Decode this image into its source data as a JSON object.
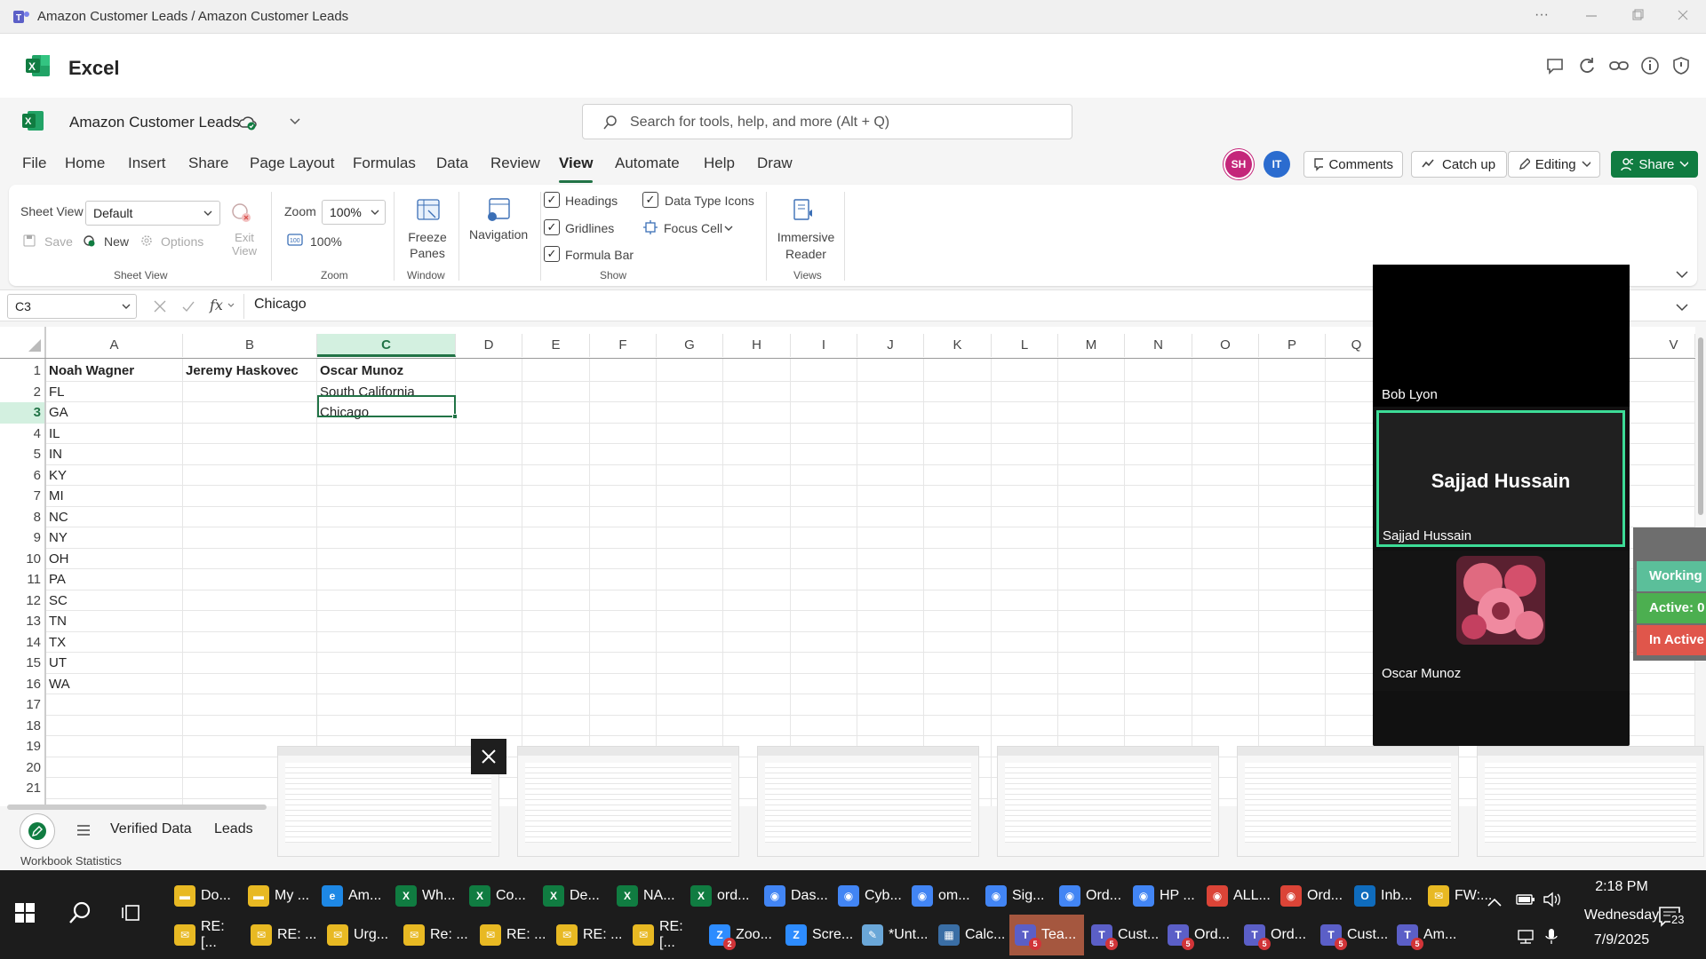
{
  "titlebar": {
    "title": "Amazon Customer Leads / Amazon Customer Leads",
    "more": "···"
  },
  "excel": {
    "app_name": "Excel"
  },
  "doc": {
    "title": "Amazon Customer Leads",
    "search_placeholder": "Search for tools, help, and more (Alt + Q)"
  },
  "menu": {
    "tabs": [
      "File",
      "Home",
      "Insert",
      "Share",
      "Page Layout",
      "Formulas",
      "Data",
      "Review",
      "View",
      "Automate",
      "Help",
      "Draw"
    ],
    "active_tab": "View",
    "avatars": [
      {
        "initials": "SH",
        "color": "#c4267a"
      },
      {
        "initials": "IT",
        "color": "#2b6ccf"
      }
    ],
    "comments": "Comments",
    "catch_up": "Catch up",
    "editing": "Editing",
    "share": "Share"
  },
  "ribbon": {
    "sheet_view_label": "Sheet View",
    "sheet_view_value": "Default",
    "save": "Save",
    "new": "New",
    "options": "Options",
    "exit_view": "Exit View",
    "group_sheet_view": "Sheet View",
    "zoom_label": "Zoom",
    "zoom_value": "100%",
    "zoom_100": "100%",
    "group_zoom": "Zoom",
    "freeze_panes": "Freeze Panes",
    "group_window": "Window",
    "navigation": "Navigation",
    "headings": "Headings",
    "gridlines": "Gridlines",
    "formula_bar": "Formula Bar",
    "data_type_icons": "Data Type Icons",
    "focus_cell": "Focus Cell",
    "group_show": "Show",
    "immersive_reader": "Immersive Reader",
    "group_views": "Views"
  },
  "formula": {
    "name_box": "C3",
    "fx": "fx",
    "value": "Chicago"
  },
  "grid": {
    "columns": [
      "A",
      "B",
      "C",
      "D",
      "E",
      "F",
      "G",
      "H",
      "I",
      "J",
      "K",
      "L",
      "M",
      "N",
      "O",
      "P",
      "Q",
      "V"
    ],
    "selected_column": "C",
    "rows": [
      "1",
      "2",
      "3",
      "4",
      "5",
      "6",
      "7",
      "8",
      "9",
      "10",
      "11",
      "12",
      "13",
      "14",
      "15",
      "16",
      "17",
      "18",
      "19",
      "20",
      "21"
    ],
    "selected_row": "3",
    "cells": {
      "A": [
        "Noah Wagner",
        "FL",
        "GA",
        "IL",
        "IN",
        "KY",
        "MI",
        "NC",
        "NY",
        "OH",
        "PA",
        "SC",
        "TN",
        "TX",
        "UT",
        "WA"
      ],
      "B": [
        "Jeremy Haskovec"
      ],
      "C": [
        "Oscar Munoz",
        "South California",
        "Chicago"
      ]
    }
  },
  "meeting": {
    "participants": [
      {
        "name": "Bob Lyon"
      },
      {
        "name": "Sajjad Hussain",
        "big_label": "Sajjad Hussain"
      },
      {
        "name": "Oscar Munoz"
      }
    ]
  },
  "status_pills": [
    {
      "label": "Working",
      "color": "#5bbf9a"
    },
    {
      "label": "Active: 0",
      "color": "#4caf50"
    },
    {
      "label": "In Active",
      "color": "#e0564b"
    }
  ],
  "sheet_tabs": [
    "Verified Data",
    "Leads"
  ],
  "statusbar": {
    "text": "Workbook Statistics"
  },
  "taskbar": {
    "row1": [
      {
        "label": "Do...",
        "icon": "folder",
        "color": "#e8b923"
      },
      {
        "label": "My ...",
        "icon": "folder",
        "color": "#e8b923"
      },
      {
        "label": "Am...",
        "icon": "edge",
        "color": "#1e88e5"
      },
      {
        "label": "Wh...",
        "icon": "excel",
        "color": "#107c41"
      },
      {
        "label": "Co...",
        "icon": "excel",
        "color": "#107c41"
      },
      {
        "label": "De...",
        "icon": "excel",
        "color": "#107c41"
      },
      {
        "label": "NA...",
        "icon": "excel",
        "color": "#107c41"
      },
      {
        "label": "ord...",
        "icon": "excel",
        "color": "#107c41"
      },
      {
        "label": "Das...",
        "icon": "chrome",
        "color": "#4285f4"
      },
      {
        "label": "Cyb...",
        "icon": "chrome",
        "color": "#4285f4"
      },
      {
        "label": "om...",
        "icon": "chrome",
        "color": "#4285f4"
      },
      {
        "label": "Sig...",
        "icon": "chrome",
        "color": "#4285f4"
      },
      {
        "label": "Ord...",
        "icon": "chrome",
        "color": "#4285f4"
      },
      {
        "label": "HP ...",
        "icon": "chrome",
        "color": "#4285f4"
      },
      {
        "label": "ALL...",
        "icon": "chrome",
        "color": "#db4437"
      },
      {
        "label": "Ord...",
        "icon": "chrome",
        "color": "#db4437"
      },
      {
        "label": "Inb...",
        "icon": "outlook",
        "color": "#0f6cbd"
      },
      {
        "label": "FW:...",
        "icon": "mail",
        "color": "#e8b923"
      }
    ],
    "row2": [
      {
        "label": "RE: [...",
        "icon": "mail",
        "color": "#e8b923"
      },
      {
        "label": "RE: ...",
        "icon": "mail",
        "color": "#e8b923"
      },
      {
        "label": "Urg...",
        "icon": "mail",
        "color": "#e8b923"
      },
      {
        "label": "Re: ...",
        "icon": "mail",
        "color": "#e8b923"
      },
      {
        "label": "RE: ...",
        "icon": "mail",
        "color": "#e8b923"
      },
      {
        "label": "RE: ...",
        "icon": "mail",
        "color": "#e8b923"
      },
      {
        "label": "RE: [...",
        "icon": "mail",
        "color": "#e8b923"
      },
      {
        "label": "Zoo...",
        "icon": "zoom",
        "color": "#2d8cff",
        "badge": "2"
      },
      {
        "label": "Scre...",
        "icon": "zoom",
        "color": "#2d8cff"
      },
      {
        "label": "*Unt...",
        "icon": "notepad",
        "color": "#6aa7d8"
      },
      {
        "label": "Calc...",
        "icon": "calculator",
        "color": "#3a6ea5"
      },
      {
        "label": "Tea...",
        "icon": "teams",
        "color": "#5b5fc7",
        "badge": "5"
      },
      {
        "label": "Cust...",
        "icon": "teams",
        "color": "#5b5fc7",
        "badge": "5"
      },
      {
        "label": "Ord...",
        "icon": "teams",
        "color": "#5b5fc7",
        "badge": "5"
      },
      {
        "label": "Ord...",
        "icon": "teams",
        "color": "#5b5fc7",
        "badge": "5"
      },
      {
        "label": "Cust...",
        "icon": "teams",
        "color": "#5b5fc7",
        "badge": "5"
      },
      {
        "label": "Am...",
        "icon": "teams",
        "color": "#5b5fc7",
        "badge": "5"
      }
    ],
    "clock_time": "2:18 PM",
    "clock_day": "Wednesday",
    "clock_date": "7/9/2025",
    "notif_count": "23"
  }
}
